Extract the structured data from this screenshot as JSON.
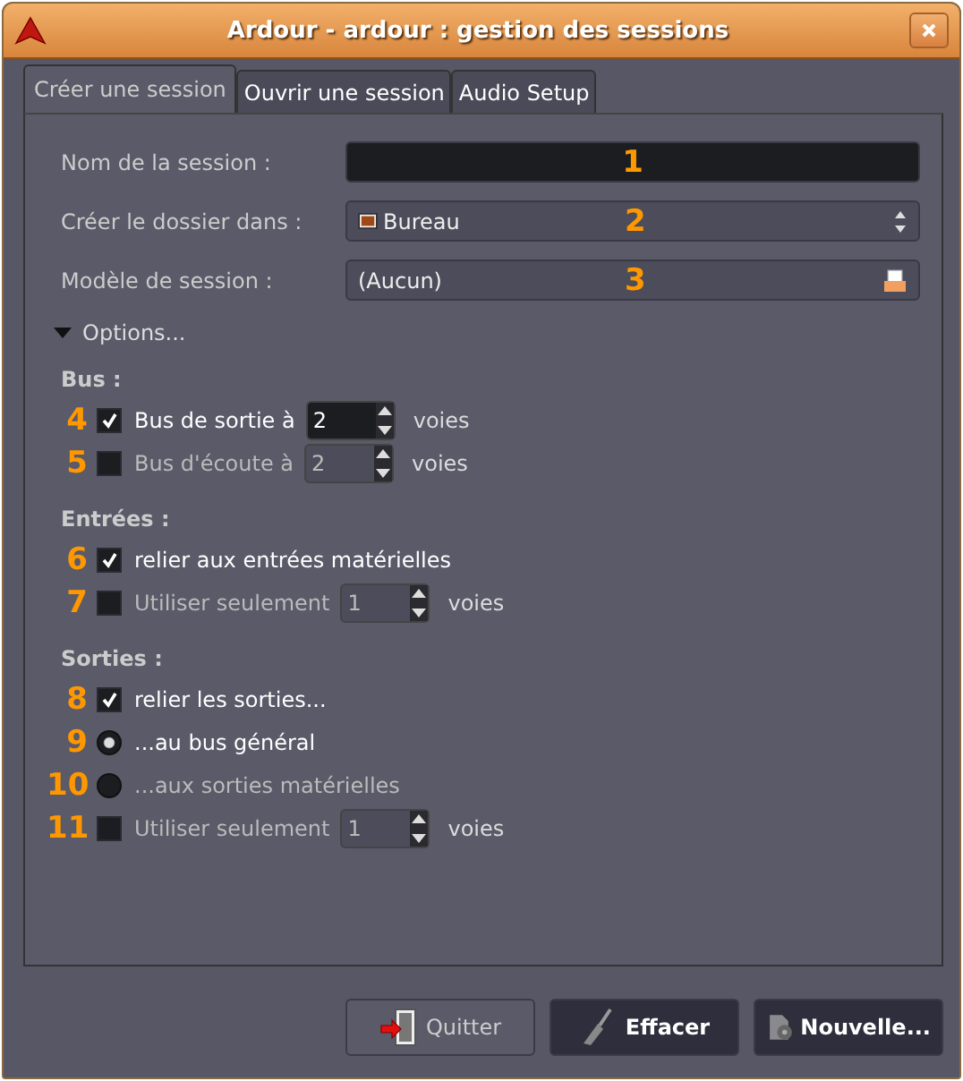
{
  "window": {
    "title": "Ardour - ardour : gestion des sessions"
  },
  "tabs": [
    {
      "label": "Créer une session",
      "selected": true
    },
    {
      "label": "Ouvrir une session",
      "selected": false
    },
    {
      "label": "Audio Setup",
      "selected": false
    }
  ],
  "fields": [
    {
      "label": "Nom de la session :",
      "kind": "entry",
      "marker": "1"
    },
    {
      "label": "Créer le dossier dans :",
      "kind": "folder",
      "value": "Bureau",
      "marker": "2"
    },
    {
      "label": "Modèle de session :",
      "kind": "file",
      "value": "(Aucun)",
      "marker": "3"
    }
  ],
  "options": {
    "label": "Options...",
    "expanded": true
  },
  "sections": [
    {
      "heading": "Bus :",
      "rows": [
        {
          "marker": "4",
          "kind": "check",
          "checked": true,
          "label": "Bus de sortie à",
          "spin": "2",
          "unit": "voies"
        },
        {
          "marker": "5",
          "kind": "check",
          "checked": false,
          "label": "Bus d'écoute à",
          "spin": "2",
          "unit": "voies"
        }
      ]
    },
    {
      "heading": "Entrées :",
      "rows": [
        {
          "marker": "6",
          "kind": "check",
          "checked": true,
          "label": "relier aux entrées matérielles"
        },
        {
          "marker": "7",
          "kind": "check",
          "checked": false,
          "label": "Utiliser seulement",
          "spin": "1",
          "unit": "voies"
        }
      ]
    },
    {
      "heading": "Sorties :",
      "rows": [
        {
          "marker": "8",
          "kind": "check",
          "checked": true,
          "label": "relier les sorties..."
        },
        {
          "marker": "9",
          "kind": "radio",
          "selected": true,
          "label": "...au bus général"
        },
        {
          "marker": "10",
          "kind": "radio",
          "selected": false,
          "label": "...aux sorties matérielles"
        },
        {
          "marker": "11",
          "kind": "check",
          "checked": false,
          "label": "Utiliser seulement",
          "spin": "1",
          "unit": "voies"
        }
      ]
    }
  ],
  "buttons": [
    {
      "label": "Quitter",
      "kind": "light"
    },
    {
      "label": "Effacer",
      "kind": "dark"
    },
    {
      "label": "Nouvelle...",
      "kind": "dark"
    }
  ]
}
